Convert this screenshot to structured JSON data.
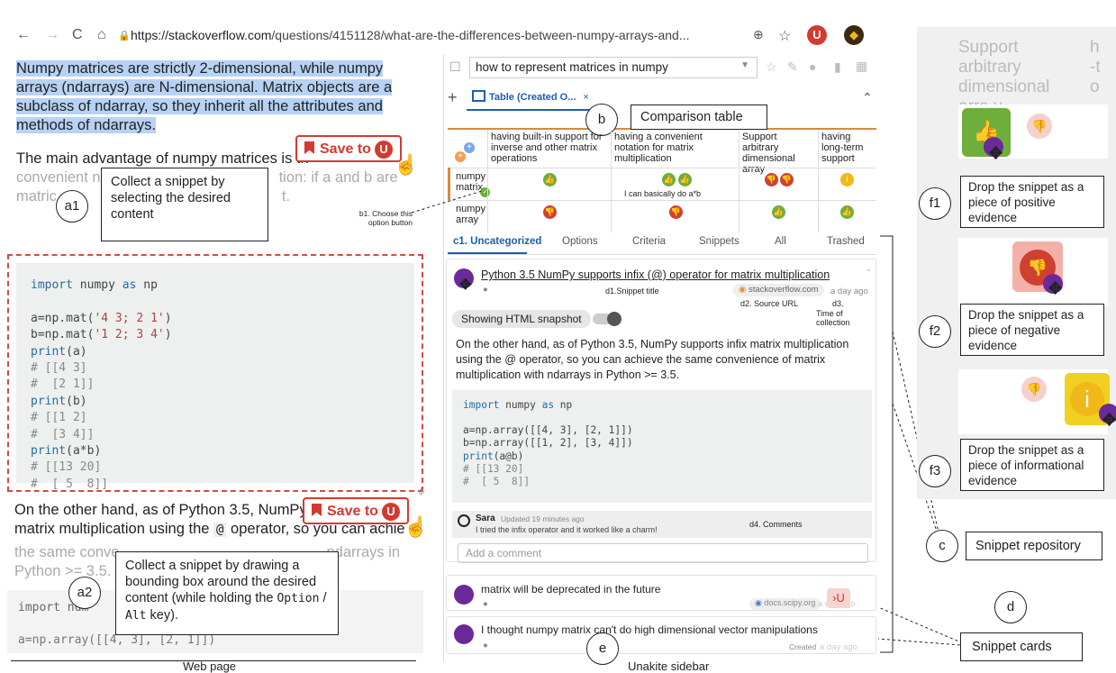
{
  "browser": {
    "url_host": "https://stackoverflow.com",
    "url_path": "/questions/4151128/what-are-the-differences-between-numpy-arrays-and..."
  },
  "webpage": {
    "highlighted_text": "Numpy matrices are strictly 2-dimensional, while numpy arrays (ndarrays) are N-dimensional. Matrix objects are a subclass of ndarray, so they inherit all the attributes and methods of ndarrays.",
    "para2_line1": "The main advantage of numpy matrices is th",
    "para2_line2a": "convenient n",
    "para2_line2b": "tion: if a and b are",
    "para2_line3a": "matric",
    "para2_line3b": "t.",
    "save_label": "Save to",
    "code": [
      [
        "kw",
        "import"
      ],
      [
        "",
        "numpy "
      ],
      [
        "kw",
        "as"
      ],
      [
        "",
        "np"
      ]
    ],
    "code_lines": [
      "",
      "a=np.mat('4 3; 2 1')",
      "b=np.mat('1 2; 3 4')",
      "print(a)",
      "# [[4 3]",
      "#  [2 1]]",
      "print(b)",
      "# [[1 2]",
      "#  [3 4]]",
      "print(a*b)",
      "# [[13 20]",
      "#  [ 5  8]]"
    ],
    "para3_line1a": "On the other hand, as of Python 3.5, NumPy",
    "para3_line2a": "matrix multiplication using the ",
    "para3_at": "@",
    "para3_line2b": " operator, so you can achie",
    "para3_line3a": "the same conve",
    "para3_line3b": "ndarrays in",
    "para3_line4": "Python >= 3.5.",
    "code3_l1a": "import num",
    "code3_l2": "a=np.array([[4, 3], [2, 1]])",
    "footer": "Web page"
  },
  "annotations": {
    "a1": "a1",
    "a1_text": "Collect a snippet by selecting the desired content",
    "a2": "a2",
    "a2_text_1": "Collect a snippet by drawing a bounding box around the desired content (while holding the ",
    "a2_opt": "Option",
    "a2_sep": " / ",
    "a2_alt": "Alt",
    "a2_end": " key).",
    "b": "b",
    "b_text": "Comparison table",
    "b1_text": "b1. Choose this option button",
    "c": "c",
    "c_text": "Snippet repository",
    "d": "d",
    "d_text": "Snippet cards",
    "e": "e",
    "f1": "f1",
    "f1_text": "Drop the snippet as a piece of positive evidence",
    "f2": "f2",
    "f2_text": "Drop the snippet as a piece of negative evidence",
    "f3": "f3",
    "f3_text": "Drop the snippet as a piece of informational evidence"
  },
  "sidebar": {
    "question": "how to represent matrices in numpy",
    "tab_label": "Table (Created O...",
    "criteria": [
      "having built-in support for inverse and other matrix operations",
      "having a convenient notation for matrix multiplication",
      "Support arbitrary dimensional array",
      "having long-term support"
    ],
    "options": [
      "numpy matrix",
      "numpy array"
    ],
    "cell_note": "I can basically do a*b",
    "nav": [
      "c1. Uncategorized",
      "Options",
      "Criteria",
      "Snippets",
      "All",
      "Trashed"
    ],
    "snippet_title": "Python 3.5 NumPy supports infix (@) operator for matrix multiplication",
    "d1": "d1.Snippet title",
    "source": "stackoverflow.com",
    "time": "a day ago",
    "d2": "d2. Source URL",
    "d3": "d3.",
    "d3b": "Time of collection",
    "snapshot": "Showing HTML snapshot",
    "snippet_body": "On the other hand, as of Python 3.5, NumPy supports infix matrix multiplication using the @ operator, so you can achieve the same convenience of matrix multiplication with ndarrays in Python >= 3.5.",
    "code_lines": [
      "import numpy as np",
      "",
      "a=np.array([[4, 3], [2, 1]])",
      "b=np.array([[1, 2], [3, 4]])",
      "print(a@b)",
      "# [[13 20]",
      "#  [ 5  8]]"
    ],
    "comment_user": "Sara",
    "comment_time": "Updated 19 minutes ago",
    "comment_text": "I tried the infix operator and it worked like a charm!",
    "d4": "d4. Comments",
    "add_comment": "Add a comment",
    "card2_title": "matrix will be deprecated in the future",
    "card2_source": "docs.scipy.org",
    "card2_time": "a day ago",
    "card3_title": "I thought numpy matrix can't do high dimensional vector manipulations",
    "card3_created": "Created",
    "card3_time": "a day ago",
    "footer": "Unakite sidebar"
  },
  "right_panel": {
    "header1": "Support arbitrary dimensional arra y",
    "header2": "h -t o"
  },
  "colors": {
    "green": "#6fae3a",
    "red": "#d04030",
    "yellow": "#f0b818",
    "purple": "#6a2a9a",
    "highlight": "#b7d2f4",
    "dashed_red": "#d24c3f"
  }
}
